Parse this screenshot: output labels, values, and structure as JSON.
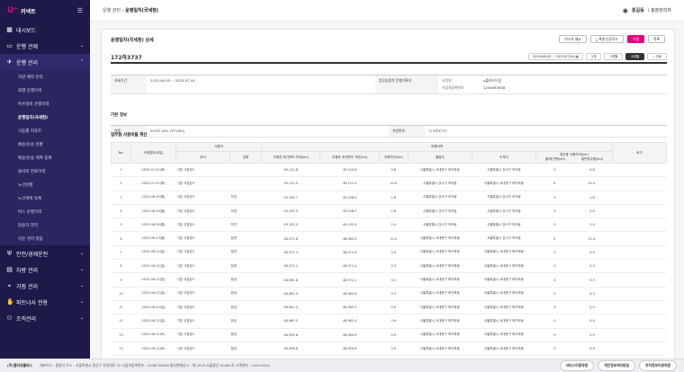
{
  "brand": {
    "logo": "U⁺",
    "name": "커넥트"
  },
  "sidebar": {
    "top": [
      {
        "label": "대시보드",
        "icon": "grid-icon"
      },
      {
        "label": "운행 관제",
        "icon": "monitor-icon"
      },
      {
        "label": "운행 관리",
        "icon": "car-icon"
      }
    ],
    "subs": [
      "차량 예약 관리",
      "회별 운행이력",
      "특수정비 운행이력",
      "운행일지(국세청)",
      "거동률 리포트",
      "배송/운송 현황",
      "배송/운송 계획 등록",
      "물비로 연료이력",
      "노선현황",
      "노선계획 등록",
      "버스 운행이력",
      "탑승자 관리",
      "미운 경지 알림"
    ],
    "bottom": [
      {
        "label": "안전/경제운전",
        "icon": "shield-icon"
      },
      {
        "label": "차량 관리",
        "icon": "truck-icon"
      },
      {
        "label": "거점 관리",
        "icon": "pin-icon"
      },
      {
        "label": "파트너사 전용",
        "icon": "handshake-icon"
      },
      {
        "label": "조직관리",
        "icon": "org-icon"
      }
    ]
  },
  "header": {
    "crumb1": "운행 관리",
    "sep": " › ",
    "crumb2": "운행일지(국세청)",
    "user_name": "홍길동",
    "user_role": "/ 총괄관리자"
  },
  "page": {
    "title": "운행일지(국세청) 상세",
    "buttons": [
      "히스토 메뉴",
      "엑셀 다운로드",
      "수정",
      "목록"
    ],
    "plate": "172하3737",
    "date_range": "2025/06/05 ~ 2025/07/04",
    "chips": [
      "1개",
      "3개월",
      "6개월"
    ],
    "search": "조회"
  },
  "info": {
    "period_label": "과세기간",
    "period": "2025-06-05 ~ 2025-07-04",
    "biz_label": "업무승용차 운행기록부",
    "org_label": "사업자",
    "org_val": "u플러스드림",
    "bizno_label": "사업자등록번호",
    "bizno_val": "1234567858",
    "basic_title": "기본 정보",
    "car_label": "차종",
    "car_val": "EV-PO HEV (YP HEV)",
    "plate_label": "차량번호",
    "plate_val": "172하3737"
  },
  "table": {
    "title": "업무용 사용비율 계산",
    "h_no": "No.",
    "h_date": "사용일자(요일)",
    "h_user": "사용자",
    "h_dept": "부서",
    "h_name": "성명",
    "h_drive": "운행내역",
    "h_before": "주행전 계기판의 거리(km)",
    "h_after": "주행후 계기판의 거리(km)",
    "h_dist": "주행거리(km)",
    "h_dep": "출발지",
    "h_dest": "도착지",
    "h_biz": "업무용 사용거리(km)",
    "h_commute": "출/퇴근용(km)",
    "h_general": "일반업무용(km)",
    "h_note": "비고",
    "rows": [
      {
        "no": "1",
        "date": "2025-07-01(화)",
        "dept": "기본 사업장3",
        "name": "",
        "before": "49,110.8",
        "after": "49,120.6",
        "dist": "9.8",
        "dep": "서울특별시 서대문구 북가좌동",
        "dest": "서울특별시 강서구 마곡동",
        "c": "0",
        "g": "9.8"
      },
      {
        "no": "2",
        "date": "2025-07-01(화)",
        "dept": "기본 사업장3",
        "name": "",
        "before": "49,110.5",
        "after": "49,121.0",
        "dist": "10.5",
        "dep": "서울특별시 강서구 마곡동",
        "dest": "서울특별시 서대문구 북가좌동",
        "c": "0",
        "g": "10.5"
      },
      {
        "no": "3",
        "date": "2025-06-30(월)",
        "dept": "기본 사업장3",
        "name": "자연",
        "before": "49,106.7",
        "after": "49,108.5",
        "dist": "1.8",
        "dep": "서울특별시 강서구 마곡동",
        "dest": "서울특별시 강서구 마곡동",
        "c": "0",
        "g": "1.8"
      },
      {
        "no": "4",
        "date": "2025-06-30(월)",
        "dept": "기본 사업장3",
        "name": "자연",
        "before": "49,105.9",
        "after": "49,108.7",
        "dist": "2.8",
        "dep": "서울특별시 강서구 마곡동",
        "dest": "서울특별시 강서구 마곡동",
        "c": "0",
        "g": "2.8"
      },
      {
        "no": "5",
        "date": "2025-06-30(월)",
        "dept": "기본 사업장3",
        "name": "자연",
        "before": "49,103.5",
        "after": "49,105.9",
        "dist": "2.4",
        "dep": "서울특별시 강서구 마곡동",
        "dest": "서울특별시 강서구 마곡동",
        "c": "0",
        "g": "2.4"
      },
      {
        "no": "6",
        "date": "2025-06-23(월)",
        "dept": "기본 사업장3",
        "name": "정연",
        "before": "48,972.8",
        "after": "48,983.2",
        "dist": "10.4",
        "dep": "서울특별시 서대문구 북가좌동",
        "dest": "서울특별시 강서구 마곡동",
        "c": "0",
        "g": "10.4"
      },
      {
        "no": "7",
        "date": "2025-06-22(일)",
        "dept": "기본 사업장3",
        "name": "정연",
        "before": "48,972.4",
        "after": "48,972.8",
        "dist": "0.4",
        "dep": "서울특별시 서대문구 북가좌동",
        "dest": "서울특별시 서대문구 북가좌동",
        "c": "0",
        "g": "0.4"
      },
      {
        "no": "8",
        "date": "2025-06-22(일)",
        "dept": "기본 사업장3",
        "name": "정연",
        "before": "48,972.1",
        "after": "48,972.4",
        "dist": "0.3",
        "dep": "서울특별시 서대문구 북가좌동",
        "dest": "서울특별시 서대문구 북가좌동",
        "c": "0",
        "g": "0.3"
      },
      {
        "no": "9",
        "date": "2025-06-22(일)",
        "dept": "기본 사업장3",
        "name": "한남",
        "before": "48,962.8",
        "after": "48,972.1",
        "dist": "9.3",
        "dep": "서울특별시 서대문구 북가좌동",
        "dest": "서울특별시 서대문구 북가좌동",
        "c": "0",
        "g": "9.3"
      },
      {
        "no": "10",
        "date": "2025-06-22(일)",
        "dept": "기본 사업장3",
        "name": "한남",
        "before": "48,962.5",
        "after": "48,962.8",
        "dist": "0.3",
        "dep": "서울특별시 서대문구 북가좌동",
        "dest": "서울특별시 서대문구 북가좌동",
        "c": "0",
        "g": "0.3"
      },
      {
        "no": "11",
        "date": "2025-06-22(일)",
        "dept": "기본 사업장3",
        "name": "한남",
        "before": "48,961.4",
        "after": "48,962.3",
        "dist": "0.9",
        "dep": "서울특별시 서대문구 북가좌동",
        "dest": "서울특별시 서대문구 북가좌동",
        "c": "0",
        "g": "0.9"
      },
      {
        "no": "12",
        "date": "2025-06-22(일)",
        "dept": "기본 사업장3",
        "name": "한남",
        "before": "48,960.5",
        "after": "48,961.4",
        "dist": "0.9",
        "dep": "서울특별시 서대문구 북가좌동",
        "dest": "서울특별시 서대문구 북가좌동",
        "c": "0",
        "g": "0.9"
      },
      {
        "no": "13",
        "date": "2025-06-21(토)",
        "dept": "기본 사업장3",
        "name": "한남",
        "before": "48,959.8",
        "after": "48,960.5",
        "dist": "0.9",
        "dep": "서울특별시 서대문구 북가좌동",
        "dest": "서울특별시 서대문구 북가좌동",
        "c": "0",
        "g": "0.9"
      },
      {
        "no": "13",
        "date": "2025-06-21(토)",
        "dept": "기본 사업장3",
        "name": "한남",
        "before": "48,958.6",
        "after": "48,959.5",
        "dist": "0.9",
        "dep": "서울특별시 서대문구 북가좌동",
        "dest": "서울특별시 서대문구 북가좌동",
        "c": "0",
        "g": "0.9"
      }
    ]
  },
  "footer": {
    "company": "(주)엘지유플러스",
    "info": "대표이사 : 홍범식   주소 : 서울특별시 용산구 한강대로 32   사업자등록번호 : 2208139938   통신판매신고 : 제 2015-서울용산-00481호   고객센터 : 1544-0010   ",
    "links": [
      "서비스이용약관",
      "개인정보처리방침",
      "위치정보이용약관"
    ]
  },
  "colors": {
    "sidebar": "#1d1a4a",
    "accent": "#e6007e"
  }
}
